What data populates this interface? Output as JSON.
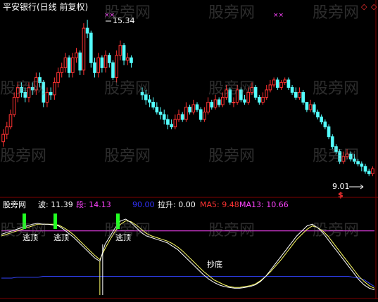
{
  "header": {
    "title": "平安银行(日线 前复权)"
  },
  "watermark": "股旁网",
  "price_panel": {
    "high_label": "15.34",
    "low_label": "9.01",
    "marker_symbol": "$",
    "cross_marks": [
      "××",
      "××"
    ],
    "diamond_marks": [
      "◇",
      "◇"
    ]
  },
  "indicator_panel": {
    "name": "股旁网",
    "items": [
      {
        "key": "波",
        "value": "11.39",
        "color": "#ffffff"
      },
      {
        "key": "段",
        "value": "14.13",
        "color": "#ff44ff"
      },
      {
        "key": "",
        "value": "90.00",
        "color": "#3333ff"
      },
      {
        "key": "拉升",
        "value": "0.00",
        "color": "#ffffff"
      },
      {
        "key": "MA5",
        "value": "9.48",
        "color": "#ff3333"
      },
      {
        "key": "MA13",
        "value": "10.66",
        "color": "#ff44ff"
      }
    ],
    "annotations": {
      "escape_top": "逃顶",
      "bottom_fishing": "抄底"
    }
  },
  "colors": {
    "up": "#ff3232",
    "down": "#54ffff",
    "background": "#000000",
    "axis": "#800000",
    "escape_bar": "#22ff22",
    "line_white": "#ffffff",
    "line_yellow": "#ffff66",
    "line_magenta": "#ff44ff",
    "line_blue": "#3344ff"
  },
  "chart_data": {
    "type": "candlestick",
    "price_range": [
      8.4,
      15.8
    ],
    "x": [
      1,
      2,
      3,
      4,
      5,
      6,
      7,
      8,
      9,
      10,
      11,
      12,
      13,
      14,
      15,
      16,
      17,
      18,
      19,
      20,
      21,
      22,
      23,
      24,
      25,
      26,
      27,
      28,
      29,
      30,
      31,
      32,
      33,
      34,
      35,
      36,
      37,
      38,
      39,
      40,
      41,
      42,
      43,
      44,
      45,
      46,
      47,
      48,
      49,
      50,
      51,
      52,
      53,
      54,
      55,
      56,
      57,
      58,
      59,
      60,
      61,
      62,
      63,
      64,
      65,
      66,
      67,
      68,
      69,
      70,
      71,
      72,
      73,
      74,
      75,
      76,
      77,
      78,
      79,
      80,
      81,
      82,
      83,
      84,
      85,
      86,
      87,
      88,
      89,
      90,
      91,
      92,
      93,
      94,
      95,
      96,
      97,
      98,
      99,
      100,
      101,
      102
    ],
    "open": [
      10.4,
      10.7,
      11.0,
      11.5,
      12.2,
      12.6,
      12.4,
      12.2,
      12.6,
      12.5,
      13.0,
      12.8,
      12.0,
      12.4,
      12.3,
      12.8,
      13.2,
      13.4,
      13.8,
      13.2,
      13.8,
      14.0,
      13.3,
      15.0,
      14.8,
      13.6,
      13.2,
      13.8,
      13.4,
      13.9,
      13.6,
      13.0,
      13.9,
      14.3,
      13.7,
      13.8,
      null,
      null,
      12.4,
      12.3,
      12.1,
      12.0,
      11.8,
      11.6,
      11.5,
      11.3,
      11.1,
      11.0,
      11.3,
      11.5,
      11.3,
      11.8,
      11.6,
      11.9,
      11.7,
      11.3,
      11.6,
      12.0,
      11.8,
      12.1,
      11.9,
      12.2,
      12.5,
      12.0,
      12.0,
      12.5,
      12.1,
      12.0,
      12.4,
      12.6,
      12.2,
      12.0,
      12.2,
      12.5,
      12.7,
      12.9,
      12.6,
      12.8,
      12.9,
      12.6,
      12.4,
      12.2,
      12.4,
      12.0,
      11.7,
      11.9,
      11.6,
      11.4,
      11.2,
      11.0,
      10.6,
      10.2,
      10.0,
      9.6,
      9.8,
      9.9,
      9.7,
      9.6,
      9.5,
      9.4,
      9.2,
      9.1
    ],
    "close": [
      10.7,
      11.0,
      11.5,
      12.2,
      12.6,
      12.4,
      12.2,
      12.6,
      12.5,
      13.0,
      12.8,
      12.0,
      12.4,
      12.3,
      12.8,
      13.2,
      13.4,
      13.8,
      13.2,
      13.8,
      14.0,
      13.3,
      15.0,
      14.8,
      13.6,
      13.2,
      13.8,
      13.4,
      13.9,
      13.6,
      13.0,
      13.9,
      14.3,
      13.7,
      13.8,
      13.6,
      null,
      null,
      12.3,
      12.1,
      12.0,
      11.8,
      11.6,
      11.5,
      11.3,
      11.1,
      11.0,
      11.3,
      11.5,
      11.3,
      11.8,
      11.6,
      11.9,
      11.7,
      11.3,
      11.6,
      12.0,
      11.8,
      12.1,
      11.9,
      12.2,
      12.5,
      12.0,
      12.0,
      12.5,
      12.1,
      12.0,
      12.4,
      12.6,
      12.2,
      12.0,
      12.2,
      12.5,
      12.7,
      12.9,
      12.6,
      12.8,
      12.9,
      12.6,
      12.4,
      12.2,
      12.4,
      12.0,
      11.7,
      11.9,
      11.6,
      11.4,
      11.2,
      11.0,
      10.6,
      10.2,
      10.0,
      9.6,
      9.8,
      9.9,
      9.7,
      9.6,
      9.5,
      9.4,
      9.2,
      9.1,
      9.3
    ],
    "high": [
      10.9,
      11.2,
      11.7,
      12.4,
      12.8,
      12.8,
      12.6,
      12.8,
      12.8,
      13.2,
      13.2,
      12.9,
      12.6,
      12.6,
      13.0,
      13.4,
      13.6,
      14.0,
      13.9,
      14.0,
      14.2,
      14.1,
      15.2,
      15.34,
      14.9,
      13.8,
      14.0,
      13.9,
      14.1,
      14.0,
      13.7,
      14.1,
      14.5,
      14.4,
      14.0,
      13.9,
      null,
      null,
      12.6,
      12.5,
      12.3,
      12.2,
      12.0,
      11.8,
      11.7,
      11.5,
      11.3,
      11.5,
      11.7,
      11.6,
      12.0,
      11.9,
      12.1,
      12.0,
      11.8,
      11.8,
      12.2,
      12.1,
      12.3,
      12.2,
      12.4,
      12.7,
      12.6,
      12.2,
      12.7,
      12.6,
      12.3,
      12.6,
      12.8,
      12.7,
      12.3,
      12.4,
      12.7,
      12.9,
      13.0,
      13.0,
      12.9,
      13.0,
      13.0,
      12.7,
      12.6,
      12.6,
      12.5,
      12.0,
      12.1,
      12.0,
      11.7,
      11.5,
      11.3,
      11.1,
      10.7,
      10.3,
      10.1,
      10.0,
      10.1,
      10.0,
      9.9,
      9.7,
      9.6,
      9.5,
      9.3,
      9.4
    ],
    "low": [
      10.2,
      10.5,
      10.9,
      11.4,
      12.0,
      12.2,
      12.0,
      12.0,
      12.3,
      12.3,
      12.6,
      11.8,
      11.8,
      12.1,
      12.1,
      12.6,
      13.0,
      13.2,
      13.0,
      13.0,
      13.6,
      13.1,
      13.1,
      14.6,
      13.4,
      13.0,
      13.0,
      13.2,
      13.2,
      13.4,
      12.9,
      12.8,
      13.7,
      13.5,
      13.5,
      13.4,
      null,
      null,
      12.1,
      11.9,
      11.8,
      11.7,
      11.5,
      11.3,
      11.1,
      10.9,
      10.9,
      10.9,
      11.2,
      11.2,
      11.2,
      11.5,
      11.5,
      11.6,
      11.2,
      11.2,
      11.5,
      11.7,
      11.7,
      11.8,
      11.8,
      12.1,
      11.9,
      11.8,
      11.9,
      12.0,
      11.9,
      11.9,
      12.3,
      12.1,
      11.9,
      11.9,
      12.1,
      12.4,
      12.6,
      12.5,
      12.5,
      12.7,
      12.5,
      12.3,
      12.1,
      12.1,
      11.9,
      11.6,
      11.6,
      11.5,
      11.3,
      11.1,
      10.9,
      10.5,
      10.1,
      9.9,
      9.5,
      9.5,
      9.7,
      9.6,
      9.5,
      9.4,
      9.2,
      9.1,
      9.01,
      9.0
    ],
    "indicator": {
      "range": [
        0,
        100
      ],
      "white": [
        72,
        74,
        76,
        78,
        80,
        82,
        84,
        85,
        84,
        84,
        83,
        82,
        78,
        73,
        68,
        62,
        56,
        50,
        44,
        40,
        60,
        70,
        80,
        88,
        90,
        86,
        80,
        74,
        70,
        68,
        66,
        64,
        62,
        58,
        54,
        48,
        42,
        36,
        30,
        24,
        19,
        15,
        12,
        10,
        9,
        8,
        8,
        9,
        10,
        12,
        16,
        22,
        30,
        38,
        46,
        54,
        62,
        70,
        76,
        82,
        84,
        80,
        74,
        66,
        58,
        50,
        42,
        34,
        26,
        18,
        12,
        8,
        6
      ],
      "yellow": [
        70,
        72,
        74,
        76,
        78,
        80,
        82,
        84,
        84,
        84,
        84,
        83,
        80,
        76,
        71,
        65,
        59,
        53,
        47,
        42,
        55,
        66,
        76,
        84,
        88,
        87,
        83,
        78,
        73,
        70,
        68,
        66,
        64,
        61,
        57,
        52,
        46,
        40,
        34,
        28,
        23,
        18,
        15,
        12,
        10,
        9,
        9,
        10,
        11,
        13,
        17,
        22,
        28,
        35,
        42,
        50,
        58,
        66,
        72,
        78,
        82,
        80,
        76,
        70,
        62,
        54,
        46,
        38,
        30,
        22,
        16,
        11,
        8
      ],
      "magenta": [
        76,
        76,
        76,
        76,
        76,
        76,
        76,
        76,
        76,
        76,
        76,
        76,
        76,
        76,
        76,
        76,
        76,
        76,
        76,
        76,
        76,
        76,
        76,
        76,
        76,
        76,
        76,
        76,
        76,
        76,
        76,
        76,
        76,
        76,
        76,
        76,
        76,
        76,
        76,
        76,
        76,
        76,
        76,
        76,
        76,
        76,
        76,
        76,
        76,
        76,
        76,
        76,
        76,
        76,
        76,
        76,
        76,
        76,
        76,
        76,
        76,
        76,
        76,
        76,
        76,
        76,
        76,
        76,
        76,
        76,
        76,
        76,
        76
      ],
      "blue": [
        20,
        20,
        20,
        21,
        21,
        21,
        21,
        21,
        22,
        22,
        22,
        22,
        22,
        22,
        22,
        22,
        22,
        22,
        22,
        22,
        22,
        22,
        22,
        22,
        22,
        22,
        22,
        22,
        22,
        22,
        22,
        22,
        22,
        22,
        22,
        22,
        22,
        22,
        22,
        22,
        22,
        22,
        22,
        22,
        22,
        22,
        22,
        22,
        22,
        22,
        22,
        22,
        22,
        22,
        22,
        22,
        22,
        22,
        22,
        22,
        22,
        22,
        22,
        22,
        22,
        22,
        22,
        22,
        21,
        20,
        18,
        14,
        10
      ],
      "spike_index": 19
    }
  }
}
